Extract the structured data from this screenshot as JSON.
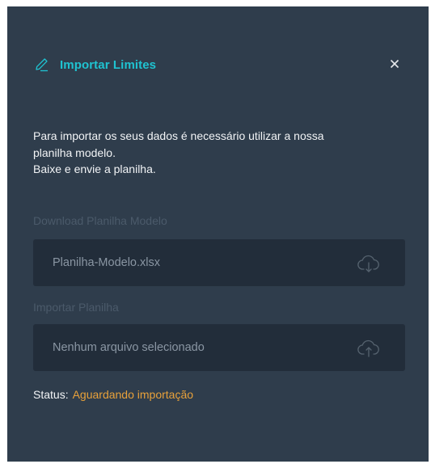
{
  "modal": {
    "title": "Importar Limites",
    "title_icon": "pencil-icon",
    "close_icon": "close-icon",
    "accent_color": "#1fc3d1"
  },
  "intro": {
    "line1": "Para importar os seus dados é necessário utilizar a nossa",
    "line2": "planilha modelo.",
    "line3": "Baixe e envie a planilha."
  },
  "download": {
    "label": "Download Planilha Modelo",
    "file_name": "Planilha-Modelo.xlsx",
    "icon": "cloud-download-icon"
  },
  "import": {
    "label": "Importar Planilha",
    "file_name": "Nenhum arquivo selecionado",
    "icon": "cloud-upload-icon"
  },
  "status": {
    "label": "Status:",
    "value": "Aguardando importação",
    "value_color": "#e8a13a"
  }
}
